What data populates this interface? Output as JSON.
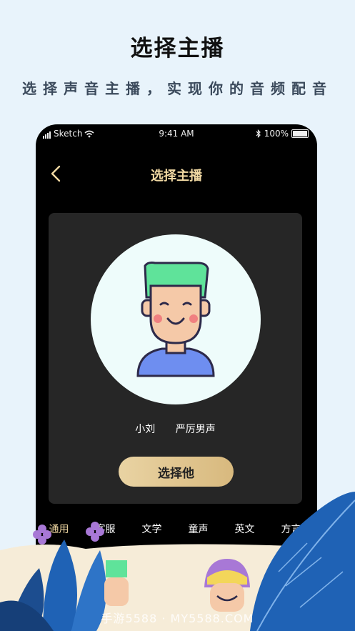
{
  "promo": {
    "headline": "选择主播",
    "subheadline": "选择声音主播，实现你的音频配音"
  },
  "status_bar": {
    "carrier": "Sketch",
    "time": "9:41 AM",
    "battery": "100%"
  },
  "nav": {
    "title": "选择主播",
    "back_icon": "chevron-left-icon"
  },
  "anchor_card": {
    "name": "小刘",
    "voice_type": "严厉男声",
    "select_label": "选择他"
  },
  "categories": [
    {
      "label": "通用",
      "active": true
    },
    {
      "label": "客服",
      "active": false
    },
    {
      "label": "文学",
      "active": false
    },
    {
      "label": "童声",
      "active": false
    },
    {
      "label": "英文",
      "active": false
    },
    {
      "label": "方言",
      "active": false
    }
  ],
  "watermark": "手游5588 · MY5588.COM",
  "colors": {
    "page_bg": "#e8f3fb",
    "phone_bg": "#000000",
    "card_bg": "#262626",
    "accent_gold": "#f1d9a3",
    "button_gold": "#e3c890",
    "avatar_bg": "#eefcfb",
    "hair_green": "#5fe39a",
    "shirt_blue": "#6e8ef0",
    "leaf_blue": "#1f62b5",
    "flower_purple": "#a878d6"
  }
}
